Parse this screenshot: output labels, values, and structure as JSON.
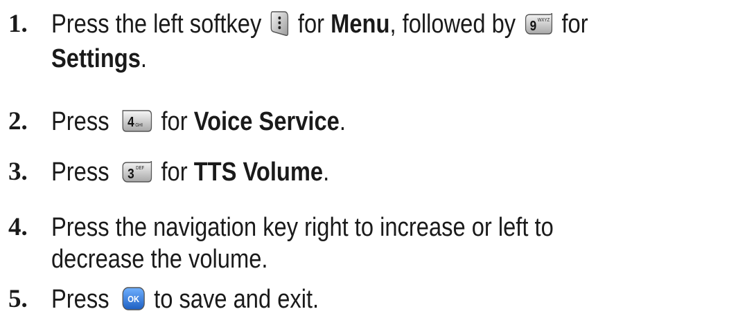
{
  "steps": [
    {
      "number": "1.",
      "line1_a": "Press the left softkey",
      "line1_b": "for",
      "line1_bold1": "Menu",
      "line1_c": ", followed by",
      "line1_d": "for",
      "line2_bold": "Settings",
      "line2_end": ".",
      "key1": {
        "icon": "left-softkey-icon",
        "glyph": "⋮"
      },
      "key2": {
        "icon": "key-9-icon",
        "digit": "9",
        "letters": "WXYZ"
      }
    },
    {
      "number": "2.",
      "a": "Press",
      "b": "for",
      "bold": "Voice Service",
      "end": ".",
      "key": {
        "icon": "key-4-icon",
        "digit": "4",
        "letters": "GHI"
      }
    },
    {
      "number": "3.",
      "a": "Press",
      "b": "for",
      "bold": "TTS Volume",
      "end": ".",
      "key": {
        "icon": "key-3-icon",
        "digit": "3",
        "letters": "DEF"
      }
    },
    {
      "number": "4.",
      "line1": "Press the navigation key right to increase or left to",
      "line2": "decrease the volume."
    },
    {
      "number": "5.",
      "a": "Press",
      "b": "to save and exit.",
      "key": {
        "icon": "ok-key-icon",
        "label": "OK",
        "color": "#2f7fe0"
      }
    }
  ]
}
